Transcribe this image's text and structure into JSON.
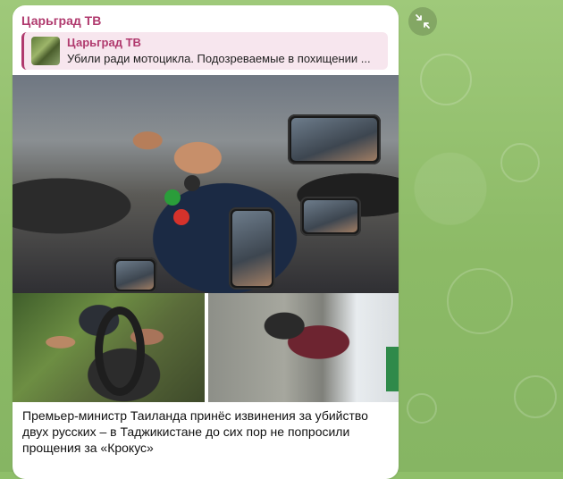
{
  "post": {
    "channel_name": "Царьград ТВ",
    "reply": {
      "title": "Царьград ТВ",
      "text": "Убили ради мотоцикла. Подозреваемые в похищении ..."
    },
    "caption": "Премьер-министр Таиланда принёс извинения за убийство двух русских – в Таджикистане до сих пор не попросили прощения за «Крокус»"
  },
  "ui": {
    "collapse_icon": "collapse-arrows-icon",
    "accent_color": "#b03a6e",
    "wallpaper_color": "#8fbf6a"
  }
}
